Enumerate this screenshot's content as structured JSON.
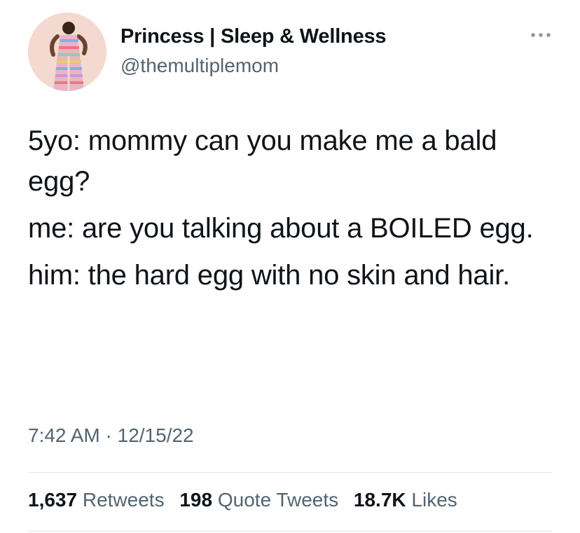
{
  "author": {
    "display_name": "Princess | Sleep & Wellness",
    "handle": "@themultiplemom"
  },
  "tweet": {
    "paragraphs": [
      "5yo: mommy can you make me a bald egg?",
      "me: are you talking about a BOILED egg.",
      "him: the hard egg with no skin and hair."
    ],
    "time": "7:42 AM",
    "separator": "·",
    "date": "12/15/22"
  },
  "stats": {
    "retweets": {
      "count": "1,637",
      "label": "Retweets"
    },
    "quote_tweets": {
      "count": "198",
      "label": "Quote Tweets"
    },
    "likes": {
      "count": "18.7K",
      "label": "Likes"
    }
  },
  "icons": {
    "more": "more-options-icon"
  },
  "colors": {
    "text_primary": "#0f1419",
    "text_secondary": "#536471",
    "divider": "#e3e7ea",
    "avatar_bg": "#f3d9cf"
  }
}
